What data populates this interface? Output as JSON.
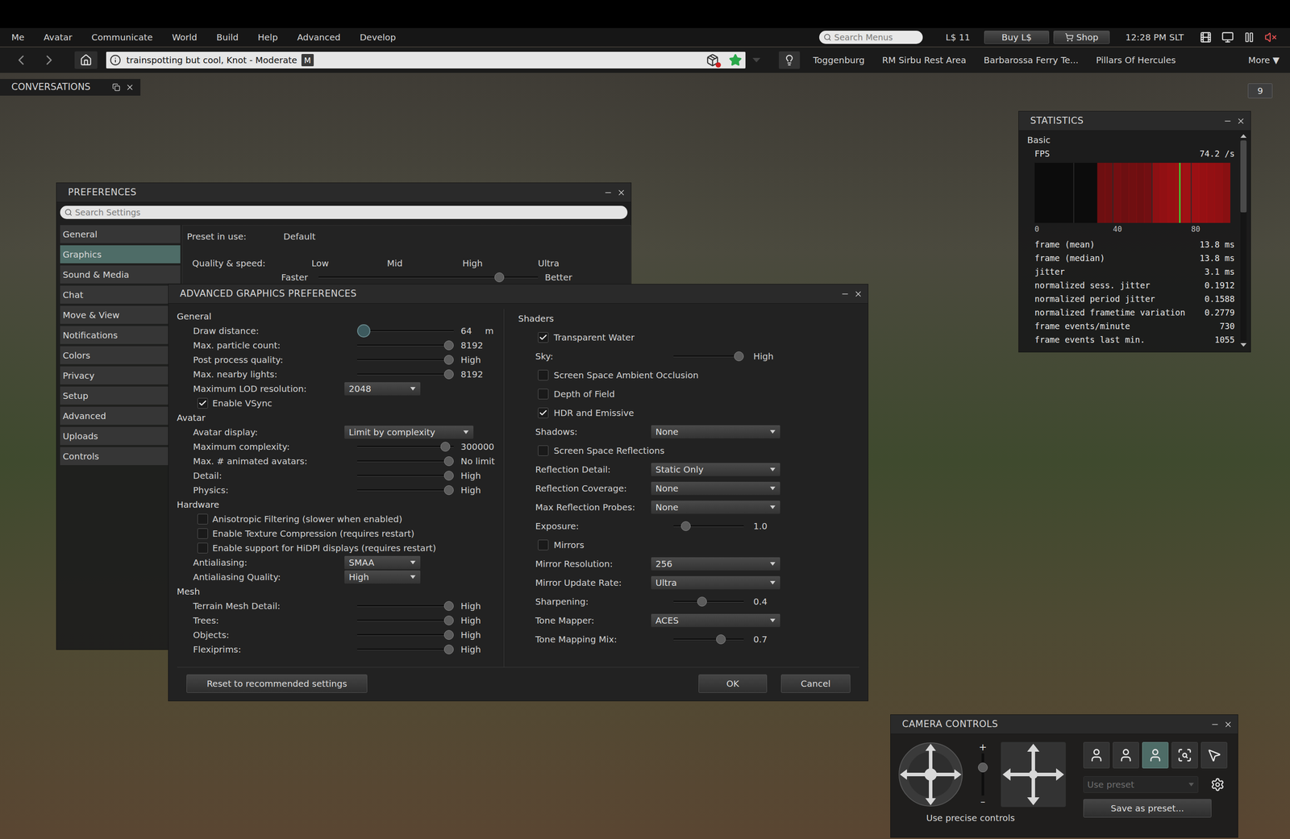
{
  "top_menu": {
    "items": [
      "Me",
      "Avatar",
      "Communicate",
      "World",
      "Build",
      "Help",
      "Advanced",
      "Develop"
    ],
    "search_placeholder": "Search Menus",
    "balance": "L$ 11",
    "buttons": [
      "Buy L$",
      "Shop"
    ],
    "time": "12:28 PM SLT"
  },
  "nav_bar": {
    "location": "trainspotting but cool, Knot - Moderate",
    "maturity": "M",
    "favorite": true,
    "favorites": [
      "Toggenburg",
      "RM Sirbu Rest Area",
      "Barbarossa Ferry Te...",
      "Pillars Of Hercules"
    ],
    "more": "More ▼"
  },
  "conversations": {
    "title": "CONVERSATIONS"
  },
  "notification_count": "9",
  "statistics": {
    "title": "STATISTICS",
    "section": "Basic",
    "fps_label": "FPS",
    "fps_value": "74.2 /s",
    "chart": {
      "axis_max": 100,
      "current": 74.2,
      "grid": [
        20,
        40,
        60,
        80
      ],
      "ticks": [
        {
          "label": "0",
          "value": 0
        },
        {
          "label": "40",
          "value": 40
        },
        {
          "label": "80",
          "value": 80
        }
      ],
      "bins": [
        0,
        0,
        0,
        0,
        0,
        0,
        0,
        0,
        0.55,
        0.55,
        0.58,
        0.55,
        0.56,
        0.55,
        0.57,
        0.72,
        0.75,
        0.78,
        0.8,
        0.82,
        0.8,
        0.78,
        0.76,
        0.74,
        0.7
      ]
    },
    "rows": [
      {
        "label": "frame (mean)",
        "value": "13.8 ms"
      },
      {
        "label": "frame (median)",
        "value": "13.8 ms"
      },
      {
        "label": "jitter",
        "value": "3.1 ms"
      },
      {
        "label": "normalized sess. jitter",
        "value": "0.1912"
      },
      {
        "label": "normalized period jitter",
        "value": "0.1588"
      },
      {
        "label": "normalized frametime variation",
        "value": "0.2779"
      },
      {
        "label": "frame events/minute",
        "value": "730"
      },
      {
        "label": "frame events last min.",
        "value": "1055"
      }
    ],
    "scroll": {
      "position": 0,
      "visible_share": 0.36
    }
  },
  "preferences": {
    "title": "PREFERENCES",
    "search_placeholder": "Search Settings",
    "tabs": [
      {
        "label": "General",
        "selected": false
      },
      {
        "label": "Graphics",
        "selected": true
      },
      {
        "label": "Sound & Media",
        "selected": false
      },
      {
        "label": "Chat",
        "selected": false
      },
      {
        "label": "Move & View",
        "selected": false
      },
      {
        "label": "Notifications",
        "selected": false
      },
      {
        "label": "Colors",
        "selected": false
      },
      {
        "label": "Privacy",
        "selected": false
      },
      {
        "label": "Setup",
        "selected": false
      },
      {
        "label": "Advanced",
        "selected": false
      },
      {
        "label": "Uploads",
        "selected": false
      },
      {
        "label": "Controls",
        "selected": false
      }
    ],
    "preset_label": "Preset in use:",
    "preset_value": "Default",
    "quality_label": "Quality & speed:",
    "quality_marks": [
      "Low",
      "Mid",
      "High",
      "Ultra"
    ],
    "faster": "Faster",
    "better": "Better",
    "quality_level": 0.84
  },
  "advanced_graphics": {
    "title": "ADVANCED GRAPHICS PREFERENCES",
    "left": [
      {
        "kind": "section",
        "label": "General"
      },
      {
        "kind": "slider",
        "label": "Draw distance:",
        "level": 0,
        "value": "64",
        "unit": "m",
        "focused": true
      },
      {
        "kind": "slider",
        "label": "Max. particle count:",
        "level": 1,
        "value": "8192",
        "unit": "",
        "focused": false
      },
      {
        "kind": "slider",
        "label": "Post process quality:",
        "level": 1,
        "value": "High",
        "unit": "",
        "focused": false
      },
      {
        "kind": "slider",
        "label": "Max. nearby lights:",
        "level": 1,
        "value": "8192",
        "unit": "",
        "focused": false
      },
      {
        "kind": "dropdown",
        "label": "Maximum LOD resolution:",
        "value": "2048"
      },
      {
        "kind": "checkbox",
        "label": "Enable VSync",
        "checked": true
      },
      {
        "kind": "section",
        "label": "Avatar"
      },
      {
        "kind": "dropdown",
        "label": "Avatar display:",
        "value": "Limit by complexity"
      },
      {
        "kind": "slider",
        "label": "Maximum complexity:",
        "level": 0.96,
        "value": "300000",
        "unit": "",
        "focused": false
      },
      {
        "kind": "slider",
        "label": "Max. # animated avatars:",
        "level": 1,
        "value": "No limit",
        "unit": "",
        "focused": false
      },
      {
        "kind": "slider",
        "label": "Detail:",
        "level": 1,
        "value": "High",
        "unit": "",
        "focused": false
      },
      {
        "kind": "slider",
        "label": "Physics:",
        "level": 1,
        "value": "High",
        "unit": "",
        "focused": false
      },
      {
        "kind": "section",
        "label": "Hardware"
      },
      {
        "kind": "checkbox",
        "label": "Anisotropic Filtering (slower when enabled)",
        "checked": false
      },
      {
        "kind": "checkbox",
        "label": "Enable Texture Compression (requires restart)",
        "checked": false
      },
      {
        "kind": "checkbox",
        "label": "Enable support for HiDPI displays (requires restart)",
        "checked": false
      },
      {
        "kind": "dropdown",
        "label": "Antialiasing:",
        "value": "SMAA"
      },
      {
        "kind": "dropdown",
        "label": "Antialiasing Quality:",
        "value": "High"
      },
      {
        "kind": "section",
        "label": "Mesh"
      },
      {
        "kind": "slider",
        "label": "Terrain Mesh Detail:",
        "level": 1,
        "value": "High",
        "unit": "",
        "focused": false
      },
      {
        "kind": "slider",
        "label": "Trees:",
        "level": 1,
        "value": "High",
        "unit": "",
        "focused": false
      },
      {
        "kind": "slider",
        "label": "Objects:",
        "level": 1,
        "value": "High",
        "unit": "",
        "focused": false
      },
      {
        "kind": "slider",
        "label": "Flexiprims:",
        "level": 1,
        "value": "High",
        "unit": "",
        "focused": false
      }
    ],
    "right": [
      {
        "kind": "section",
        "label": "Shaders"
      },
      {
        "kind": "checkbox",
        "label": "Transparent Water",
        "checked": true
      },
      {
        "kind": "slider",
        "label": "Sky:",
        "level": 1,
        "value": "High",
        "focused": false
      },
      {
        "kind": "checkbox",
        "label": "Screen Space Ambient Occlusion",
        "checked": false
      },
      {
        "kind": "checkbox",
        "label": "Depth of Field",
        "checked": false
      },
      {
        "kind": "checkbox",
        "label": "HDR and Emissive",
        "checked": true
      },
      {
        "kind": "dropdown",
        "label": "Shadows:",
        "value": "None"
      },
      {
        "kind": "checkbox",
        "label": "Screen Space Reflections",
        "checked": false
      },
      {
        "kind": "dropdown",
        "label": "Reflection Detail:",
        "value": "Static Only"
      },
      {
        "kind": "dropdown",
        "label": "Reflection Coverage:",
        "value": "None"
      },
      {
        "kind": "dropdown",
        "label": "Max Reflection Probes:",
        "value": "None"
      },
      {
        "kind": "slider",
        "label": "Exposure:",
        "level": 0.12,
        "value": "1.0",
        "focused": false
      },
      {
        "kind": "checkbox",
        "label": "Mirrors",
        "checked": false
      },
      {
        "kind": "dropdown",
        "label": "Mirror Resolution:",
        "value": "256"
      },
      {
        "kind": "dropdown",
        "label": "Mirror Update Rate:",
        "value": "Ultra"
      },
      {
        "kind": "slider",
        "label": "Sharpening:",
        "level": 0.39,
        "value": "0.4",
        "focused": false
      },
      {
        "kind": "dropdown",
        "label": "Tone Mapper:",
        "value": "ACES"
      },
      {
        "kind": "slider",
        "label": "Tone Mapping Mix:",
        "level": 0.7,
        "value": "0.7",
        "focused": false
      }
    ],
    "buttons": [
      "Reset to recommended settings",
      "OK",
      "Cancel"
    ]
  },
  "camera_controls": {
    "title": "CAMERA CONTROLS",
    "zoom_in": "+",
    "zoom_out": "–",
    "zoom_level": 0.72,
    "caption": "Use precise controls",
    "views": [
      {
        "kind": "front",
        "selected": false
      },
      {
        "kind": "side",
        "selected": false
      },
      {
        "kind": "rear",
        "selected": true
      },
      {
        "kind": "object",
        "selected": false
      },
      {
        "kind": "mouse",
        "selected": false
      }
    ],
    "preset_placeholder": "Use preset",
    "preset_disabled": true,
    "save_button": "Save as preset..."
  }
}
